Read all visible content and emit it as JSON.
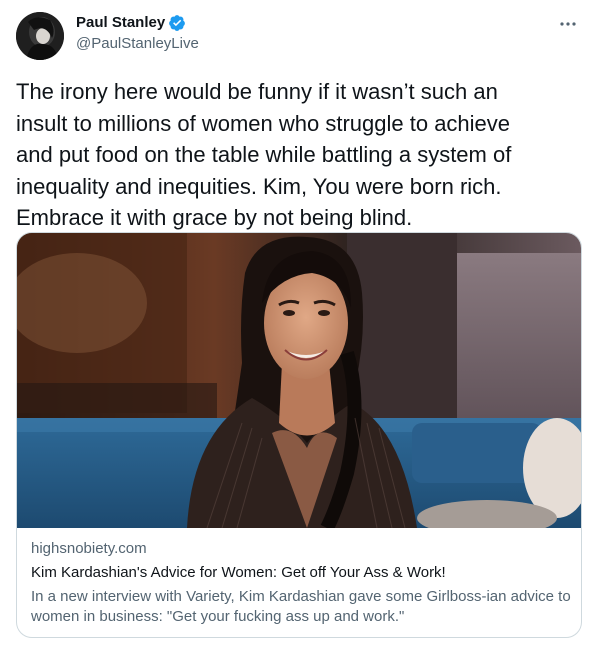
{
  "author": {
    "display_name": "Paul Stanley",
    "handle": "@PaulStanleyLive",
    "verified_icon": "verified-badge-icon",
    "avatar_icon": "avatar"
  },
  "tweet": {
    "text": "The irony here would be funny if it wasn’t such an\ninsult to millions of women who struggle to achieve\nand put food on the table while battling a system of\ninequality and inequities. Kim, You were born rich.\nEmbrace it with grace by not being blind."
  },
  "card": {
    "domain": "highsnobiety.com",
    "title": "Kim Kardashian's Advice for Women: Get off Your Ass & Work!",
    "description": "In a new interview with Variety, Kim Kardashian gave some Girlboss-ian advice to women in business: \"Get your fucking ass up and work.\""
  },
  "colors": {
    "text_primary": "#0f1419",
    "text_secondary": "#536471",
    "verified_blue": "#1d9bf0",
    "border": "#cfd9de"
  }
}
